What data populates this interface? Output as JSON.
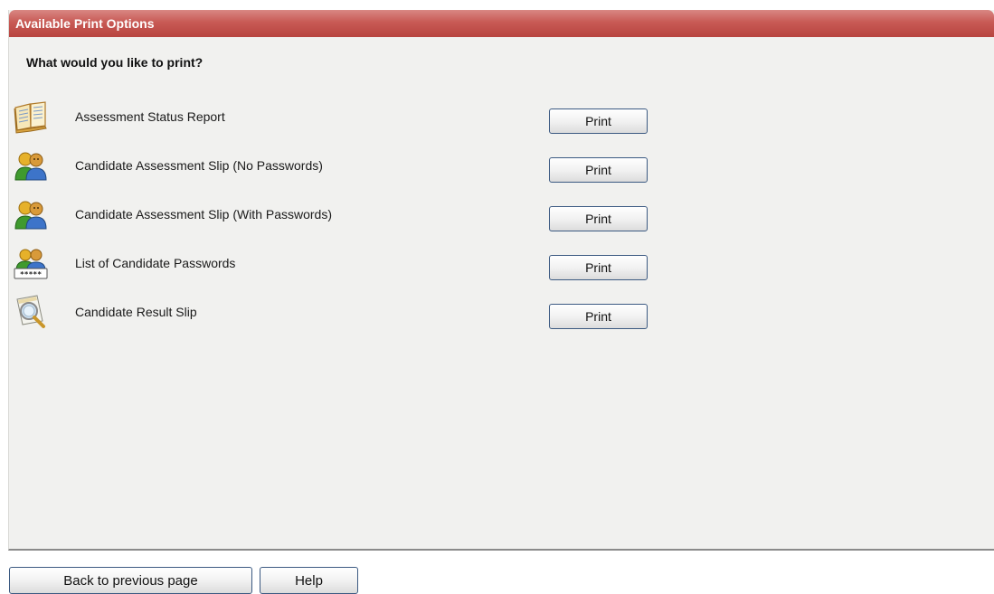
{
  "panel": {
    "title": "Available Print Options",
    "question": "What would you like to print?"
  },
  "options": [
    {
      "label": "Assessment Status Report",
      "icon": "report-book-icon",
      "button": "Print"
    },
    {
      "label": "Candidate Assessment Slip (No Passwords)",
      "icon": "candidates-icon",
      "button": "Print"
    },
    {
      "label": "Candidate Assessment Slip (With Passwords)",
      "icon": "candidates-icon",
      "button": "Print"
    },
    {
      "label": "List of Candidate Passwords",
      "icon": "candidate-passwords-icon",
      "button": "Print",
      "icon_text": "*****"
    },
    {
      "label": "Candidate Result Slip",
      "icon": "magnifier-document-icon",
      "button": "Print"
    }
  ],
  "footer": {
    "back_label": "Back to previous page",
    "help_label": "Help"
  },
  "colors": {
    "header_red": "#c85a55",
    "panel_bg": "#f1f1ef",
    "button_border": "#3c5a82"
  }
}
